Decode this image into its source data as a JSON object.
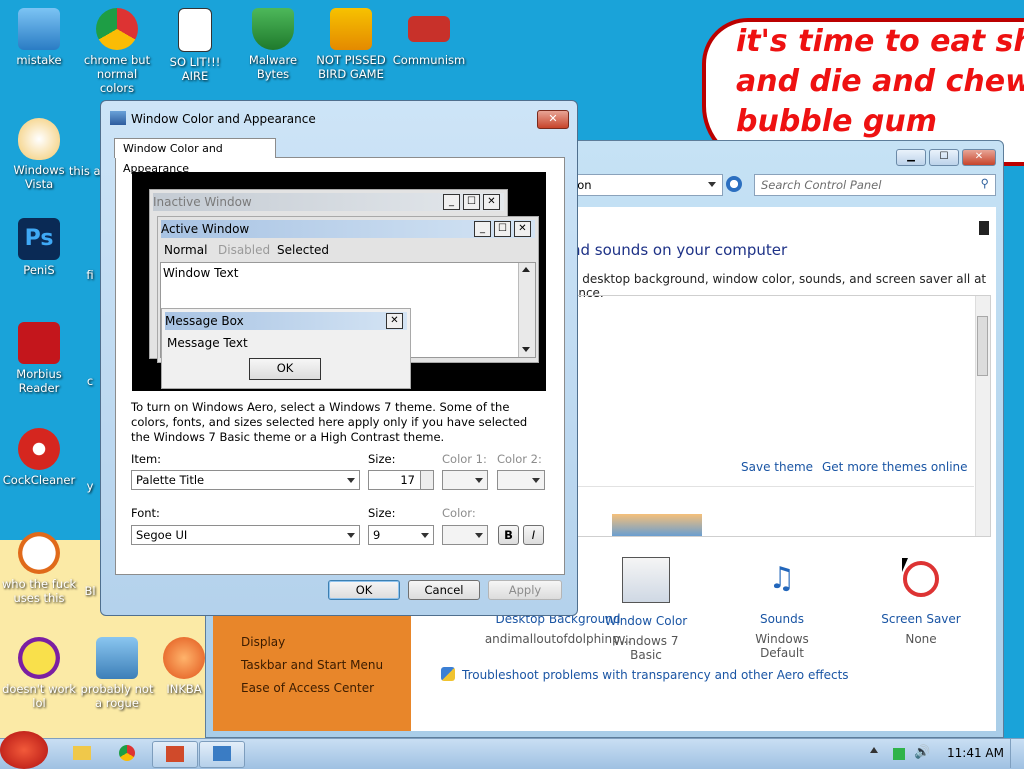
{
  "desktop": {
    "icons": [
      {
        "label": "mistake"
      },
      {
        "label": "chrome but normal colors"
      },
      {
        "label": "SO LIT!!! AIRE"
      },
      {
        "label": "Malware Bytes"
      },
      {
        "label": "NOT PISSED BIRD GAME"
      },
      {
        "label": "Communism"
      },
      {
        "label": "Windows Vista"
      },
      {
        "label": "this a v"
      },
      {
        "label": "PeniS"
      },
      {
        "label": "fi"
      },
      {
        "label": "Morbius Reader"
      },
      {
        "label": "c"
      },
      {
        "label": "CockCleaner"
      },
      {
        "label": "y"
      },
      {
        "label": "who the fuck uses this"
      },
      {
        "label": "Bl"
      },
      {
        "label": "doesn't work lol"
      },
      {
        "label": "probably not a rogue"
      },
      {
        "label": "INKBA"
      }
    ],
    "bubble_lines": [
      "it's time to eat shit",
      "and die and chew",
      "bubble gum"
    ]
  },
  "control_panel": {
    "address_fragment": "ion",
    "search_placeholder": "Search Control Panel",
    "heading": "nd sounds on your computer",
    "subheading": "e desktop background, window color, sounds, and screen saver all at once.",
    "save_theme": "Save theme",
    "get_more_themes": "Get more themes online",
    "side_links": [
      "Display",
      "Taskbar and Start Menu",
      "Ease of Access Center"
    ],
    "tiles": [
      {
        "title": "Desktop Background",
        "sub": "andimalloutofdolphinp..."
      },
      {
        "title": "Window Color",
        "sub": "Windows 7 Basic"
      },
      {
        "title": "Sounds",
        "sub": "Windows Default"
      },
      {
        "title": "Screen Saver",
        "sub": "None"
      }
    ],
    "troubleshoot": "Troubleshoot problems with transparency and other Aero effects"
  },
  "dialog": {
    "title": "Window Color and Appearance",
    "tab": "Window Color and Appearance",
    "preview": {
      "inactive_title": "Inactive Window",
      "active_title": "Active Window",
      "menu": [
        "Normal",
        "Disabled",
        "Selected"
      ],
      "window_text": "Window Text",
      "msgbox_title": "Message Box",
      "msgbox_text": "Message Text",
      "ok": "OK"
    },
    "info": "To turn on Windows Aero, select a Windows 7 theme.  Some of the colors, fonts, and sizes selected here apply only if you have selected the Windows 7 Basic theme or a High Contrast theme.",
    "item_label": "Item:",
    "item_value": "Palette Title",
    "size_label": "Size:",
    "size_value": "17",
    "color1_label": "Color 1:",
    "color2_label": "Color 2:",
    "font_label": "Font:",
    "font_value": "Segoe UI",
    "font_size_label": "Size:",
    "font_size_value": "9",
    "font_color_label": "Color:",
    "bold": "B",
    "italic": "I",
    "ok": "OK",
    "cancel": "Cancel",
    "apply": "Apply"
  },
  "taskbar": {
    "clock": "11:41 AM"
  }
}
